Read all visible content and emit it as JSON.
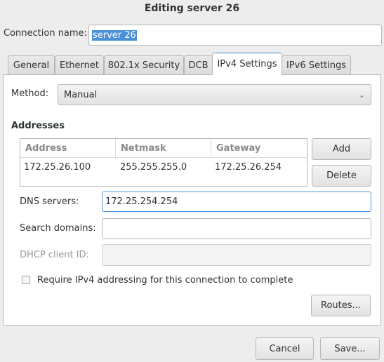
{
  "window": {
    "title": "Editing server 26"
  },
  "connection_name": {
    "label": "Connection name:",
    "value": "server 26"
  },
  "tabs": [
    {
      "label": "General"
    },
    {
      "label": "Ethernet"
    },
    {
      "label": "802.1x Security"
    },
    {
      "label": "DCB"
    },
    {
      "label": "IPv4 Settings",
      "active": true
    },
    {
      "label": "IPv6 Settings"
    }
  ],
  "method": {
    "label": "Method:",
    "value": "Manual"
  },
  "addresses": {
    "heading": "Addresses",
    "columns": [
      "Address",
      "Netmask",
      "Gateway"
    ],
    "rows": [
      [
        "172.25.26.100",
        "255.255.255.0",
        "172.25.26.254"
      ]
    ],
    "add_label": "Add",
    "delete_label": "Delete"
  },
  "dns": {
    "label": "DNS servers:",
    "value": "172.25.254.254"
  },
  "search_domains": {
    "label": "Search domains:",
    "value": ""
  },
  "dhcp_client_id": {
    "label": "DHCP client ID:",
    "value": ""
  },
  "require_ipv4": {
    "label": "Require IPv4 addressing for this connection to complete",
    "checked": false
  },
  "routes_label": "Routes...",
  "footer": {
    "cancel_label": "Cancel",
    "save_label": "Save..."
  },
  "colors": {
    "accent": "#4a90d9"
  }
}
